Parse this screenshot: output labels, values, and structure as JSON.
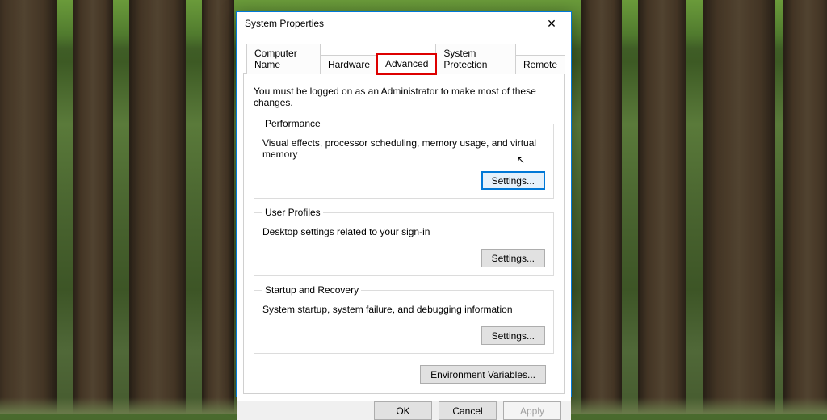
{
  "dialog": {
    "title": "System Properties",
    "close_glyph": "✕"
  },
  "tabs": {
    "computer_name": "Computer Name",
    "hardware": "Hardware",
    "advanced": "Advanced",
    "system_protection": "System Protection",
    "remote": "Remote",
    "active": "advanced"
  },
  "advanced_page": {
    "admin_note": "You must be logged on as an Administrator to make most of these changes.",
    "performance": {
      "legend": "Performance",
      "desc": "Visual effects, processor scheduling, memory usage, and virtual memory",
      "button": "Settings..."
    },
    "user_profiles": {
      "legend": "User Profiles",
      "desc": "Desktop settings related to your sign-in",
      "button": "Settings..."
    },
    "startup_recovery": {
      "legend": "Startup and Recovery",
      "desc": "System startup, system failure, and debugging information",
      "button": "Settings..."
    },
    "env_vars": "Environment Variables..."
  },
  "footer": {
    "ok": "OK",
    "cancel": "Cancel",
    "apply": "Apply"
  }
}
